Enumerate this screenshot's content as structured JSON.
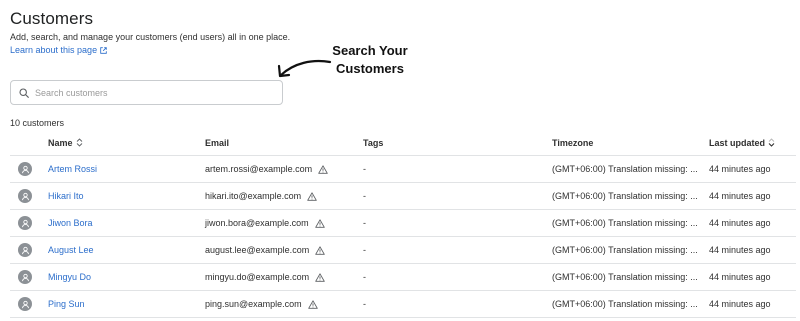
{
  "page": {
    "title": "Customers",
    "description": "Add, search, and manage your customers (end users) all in one place.",
    "learn_link": "Learn about this page"
  },
  "annotation": {
    "line1": "Search Your",
    "line2": "Customers"
  },
  "search": {
    "placeholder": "Search customers"
  },
  "count_text": "10 customers",
  "table": {
    "headers": {
      "name": "Name",
      "email": "Email",
      "tags": "Tags",
      "timezone": "Timezone",
      "updated": "Last updated"
    },
    "rows": [
      {
        "name": "Artem Rossi",
        "email": "artem.rossi@example.com",
        "tags": "-",
        "timezone": "(GMT+06:00) Translation missing: ...",
        "updated": "44 minutes ago"
      },
      {
        "name": "Hikari Ito",
        "email": "hikari.ito@example.com",
        "tags": "-",
        "timezone": "(GMT+06:00) Translation missing: ...",
        "updated": "44 minutes ago"
      },
      {
        "name": "Jiwon Bora",
        "email": "jiwon.bora@example.com",
        "tags": "-",
        "timezone": "(GMT+06:00) Translation missing: ...",
        "updated": "44 minutes ago"
      },
      {
        "name": "August Lee",
        "email": "august.lee@example.com",
        "tags": "-",
        "timezone": "(GMT+06:00) Translation missing: ...",
        "updated": "44 minutes ago"
      },
      {
        "name": "Mingyu Do",
        "email": "mingyu.do@example.com",
        "tags": "-",
        "timezone": "(GMT+06:00) Translation missing: ...",
        "updated": "44 minutes ago"
      },
      {
        "name": "Ping Sun",
        "email": "ping.sun@example.com",
        "tags": "-",
        "timezone": "(GMT+06:00) Translation missing: ...",
        "updated": "44 minutes ago"
      }
    ]
  },
  "icons": {
    "search": "search-icon",
    "external_link": "external-link-icon",
    "avatar": "person-icon",
    "warning": "warning-icon",
    "sort": "sort-icon",
    "arrow": "curved-arrow-icon"
  },
  "colors": {
    "link": "#2c6ecb",
    "border": "#e1e3e5",
    "avatar": "#8c9196"
  }
}
